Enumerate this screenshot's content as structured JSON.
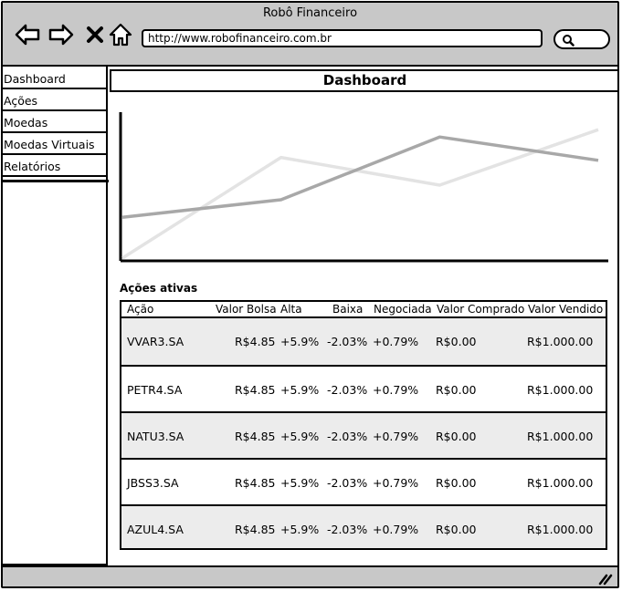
{
  "window": {
    "title": "Robô Financeiro"
  },
  "browser": {
    "url": "http://www.robofinanceiro.com.br"
  },
  "sidebar": {
    "items": [
      "Dashboard",
      "Ações",
      "Moedas",
      "Moedas Virtuais",
      "Relatórios"
    ]
  },
  "page": {
    "title": "Dashboard"
  },
  "chart_data": {
    "type": "line",
    "title": "",
    "xlabel": "",
    "ylabel": "",
    "x": [
      0,
      1,
      2,
      3
    ],
    "ylim": [
      0,
      10
    ],
    "grid": false,
    "series": [
      {
        "values": [
          0,
          6.9,
          5,
          8.8
        ],
        "color": "#e3e3e3"
      },
      {
        "values": [
          2.8,
          4,
          8.3,
          6.7
        ],
        "color": "#a8a8a8"
      }
    ]
  },
  "table": {
    "title": "Ações ativas",
    "headers": [
      "Ação",
      "Valor Bolsa",
      "Alta",
      "Baixa",
      "Negociada",
      "Valor Comprado",
      "Valor Vendido"
    ],
    "rows": [
      [
        "VVAR3.SA",
        "R$4.85",
        "+5.9%",
        "-2.03%",
        "+0.79%",
        "R$0.00",
        "R$1.000.00"
      ],
      [
        "PETR4.SA",
        "R$4.85",
        "+5.9%",
        "-2.03%",
        "+0.79%",
        "R$0.00",
        "R$1.000.00"
      ],
      [
        "NATU3.SA",
        "R$4.85",
        "+5.9%",
        "-2.03%",
        "+0.79%",
        "R$0.00",
        "R$1.000.00"
      ],
      [
        "JBSS3.SA",
        "R$4.85",
        "+5.9%",
        "-2.03%",
        "+0.79%",
        "R$0.00",
        "R$1.000.00"
      ],
      [
        "AZUL4.SA",
        "R$4.85",
        "+5.9%",
        "-2.03%",
        "+0.79%",
        "R$0.00",
        "R$1.000.00"
      ]
    ]
  }
}
